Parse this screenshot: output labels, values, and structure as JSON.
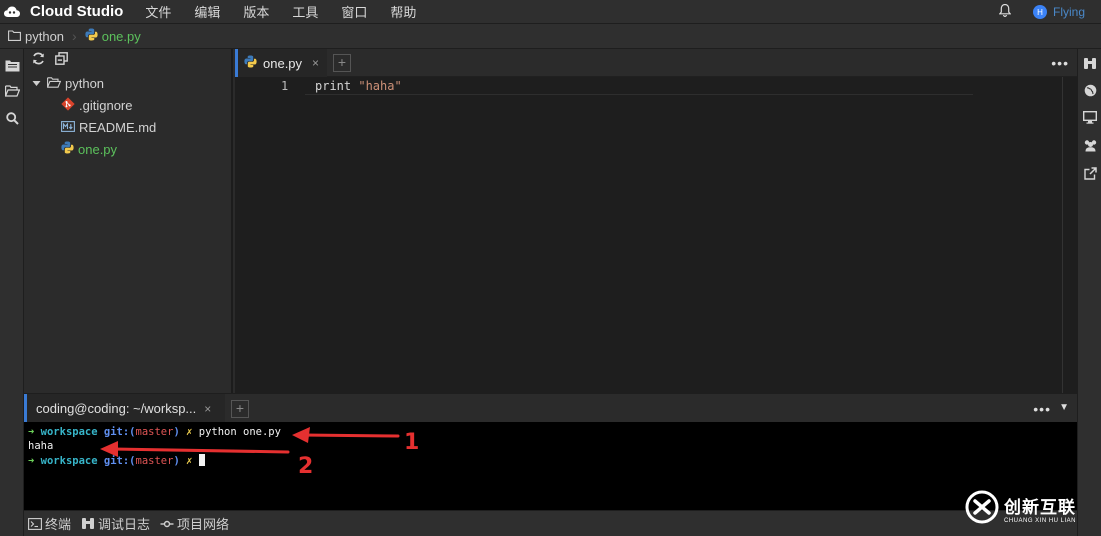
{
  "app": {
    "title": "Cloud Studio",
    "menus": [
      "文件",
      "编辑",
      "版本",
      "工具",
      "窗口",
      "帮助"
    ],
    "user_initial": "H",
    "user_name": "Flying"
  },
  "breadcrumb": {
    "project": "python",
    "file": "one.py"
  },
  "file_tree": {
    "root": "python",
    "items": [
      {
        "label": ".gitignore",
        "icon": "git-icon"
      },
      {
        "label": "README.md",
        "icon": "markdown-icon"
      },
      {
        "label": "one.py",
        "icon": "python-icon",
        "active": true
      }
    ]
  },
  "editor": {
    "tab_label": "one.py",
    "tab_close": "×",
    "line_number": "1",
    "code_keyword": "print ",
    "code_string": "\"haha\""
  },
  "terminal": {
    "tab_label": "coding@coding: ~/worksp...",
    "tab_close": "×",
    "lines": [
      {
        "arrow": "➜",
        "dir": "workspace",
        "git": "git:(",
        "branch": "master",
        "git_end": ")",
        "x": "✗",
        "cmd": "python one.py"
      },
      {
        "output": "haha"
      },
      {
        "arrow": "➜",
        "dir": "workspace",
        "git": "git:(",
        "branch": "master",
        "git_end": ")",
        "x": "✗",
        "cmd": ""
      }
    ]
  },
  "annotations": {
    "label1": "1",
    "label2": "2"
  },
  "statusbar": {
    "terminal": "终端",
    "debug_log": "调试日志",
    "project_network": "项目网络"
  },
  "watermark": {
    "cn": "创新互联",
    "en": "CHUANG XIN HU LIAN"
  },
  "colors": {
    "accent": "#3a7bd5",
    "active_file": "#5cc15c",
    "annotation": "#e53030"
  }
}
